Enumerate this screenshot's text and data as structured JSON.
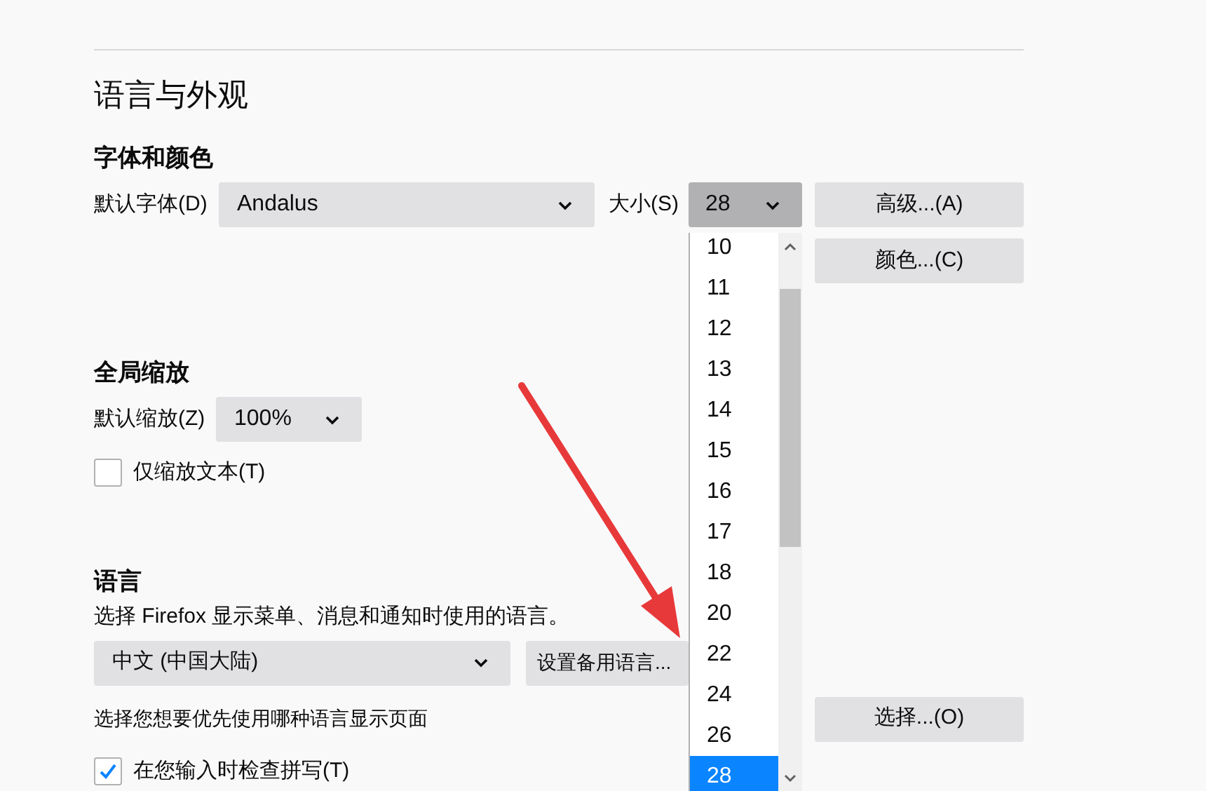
{
  "section_title": "语言与外观",
  "fonts": {
    "heading": "字体和颜色",
    "font_label": "默认字体(D)",
    "font_value": "Andalus",
    "size_label": "大小(S)",
    "size_value": "28",
    "size_open": true,
    "advanced_button": "高级...(A)",
    "colors_button": "颜色...(C)",
    "size_options": [
      {
        "label": "10",
        "selected": false
      },
      {
        "label": "11",
        "selected": false
      },
      {
        "label": "12",
        "selected": false
      },
      {
        "label": "13",
        "selected": false
      },
      {
        "label": "14",
        "selected": false
      },
      {
        "label": "15",
        "selected": false
      },
      {
        "label": "16",
        "selected": false
      },
      {
        "label": "17",
        "selected": false
      },
      {
        "label": "18",
        "selected": false
      },
      {
        "label": "20",
        "selected": false
      },
      {
        "label": "22",
        "selected": false
      },
      {
        "label": "24",
        "selected": false
      },
      {
        "label": "26",
        "selected": false
      },
      {
        "label": "28",
        "selected": true
      }
    ]
  },
  "zoom": {
    "heading": "全局缩放",
    "label": "默认缩放(Z)",
    "value": "100%",
    "text_only": {
      "label": "仅缩放文本(T)",
      "checked": false
    }
  },
  "language": {
    "heading": "语言",
    "description": "选择 Firefox 显示菜单、消息和通知时使用的语言。",
    "value": "中文 (中国大陆)",
    "alternatives_button": "设置备用语言...",
    "page_language_label": "选择您想要优先使用哪种语言显示页面",
    "choose_button": "选择...(O)",
    "spellcheck": {
      "label": "在您输入时检查拼写(T)",
      "checked": true
    }
  }
}
